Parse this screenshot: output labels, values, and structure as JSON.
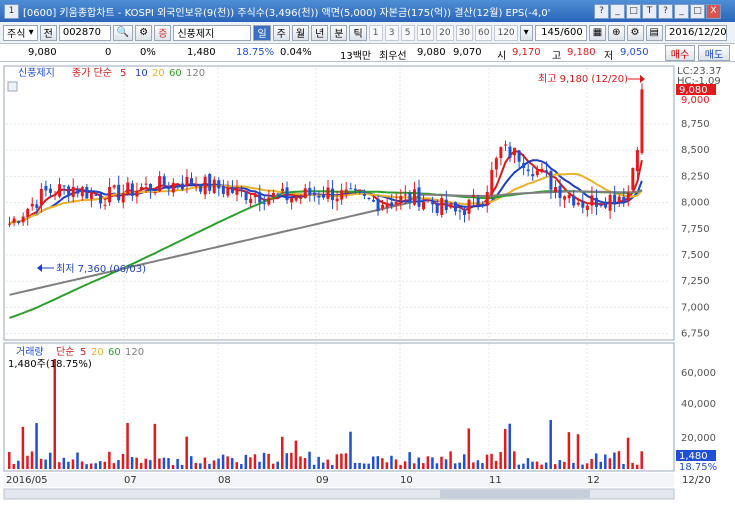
{
  "titlebar": {
    "title": "[0600] 키움종합차트 - KOSPI 외국인보유(9(천)) 주식수(3,496(천)) 액면(5,000) 자본금(175(억)) 결산(12월) EPS(-4,0'",
    "buttons": [
      "?",
      "_",
      "□",
      "T",
      "?",
      "_",
      "□",
      "X"
    ]
  },
  "toolbar": {
    "market": "주식",
    "scope": "전",
    "code": "002870",
    "stock_name": "신풍제지",
    "periods": [
      "일",
      "주",
      "월",
      "년",
      "분",
      "틱"
    ],
    "selected_period": "일",
    "intervals": [
      "1",
      "3",
      "5",
      "10",
      "20",
      "30",
      "60",
      "120"
    ],
    "count": "145/600",
    "date": "2016/12/20"
  },
  "quote": {
    "price": "9,080",
    "change": "0",
    "change_pct": "0%",
    "volume": "1,480",
    "vol_pct": "18.75%",
    "turnover": "0.04%",
    "value_label": "13백만",
    "best_ask_label": "최우선",
    "best_ask": "9,080",
    "bid2": "9,070",
    "open_label": "시",
    "open": "9,170",
    "high_label": "고",
    "high": "9,180",
    "low_label": "저",
    "low": "9,050",
    "buy_label": "매수",
    "sell_label": "매도"
  },
  "price_panel": {
    "name_label": "신풍제지",
    "ma_title": "종가 단순",
    "ma_periods": [
      "5",
      "10",
      "20",
      "60",
      "120"
    ],
    "y_ticks": [
      "8,750",
      "8,500",
      "8,250",
      "8,000",
      "7,750",
      "7,500",
      "7,250",
      "7,000",
      "6,750"
    ],
    "lc_label": "LC:23.37",
    "hc_label": "HC:-1.09",
    "last_price": "9,080",
    "last_price_2": "9,000",
    "high_note": "최고 9,180 (12/20)",
    "low_note": "최저 7,360 (06/03)"
  },
  "volume_panel": {
    "title": "거래량",
    "ma_title": "단순",
    "ma_periods": [
      "5",
      "20",
      "60",
      "120"
    ],
    "info": "1,480주(18.75%)",
    "y_ticks": [
      "60,000",
      "40,000",
      "20,000"
    ],
    "last_vol": "1,480",
    "last_pct": "18.75%"
  },
  "x_axis": {
    "labels": [
      "2016/05",
      "07",
      "08",
      "09",
      "10",
      "11",
      "12",
      "12/20"
    ]
  },
  "colors": {
    "up": "#e31a1c",
    "down": "#1f4fd6",
    "ma5": "#d61a1a",
    "ma10": "#1f3fbf",
    "ma20": "#e8b22a",
    "ma60": "#2ca02c",
    "ma120": "#7f7f7f"
  }
}
